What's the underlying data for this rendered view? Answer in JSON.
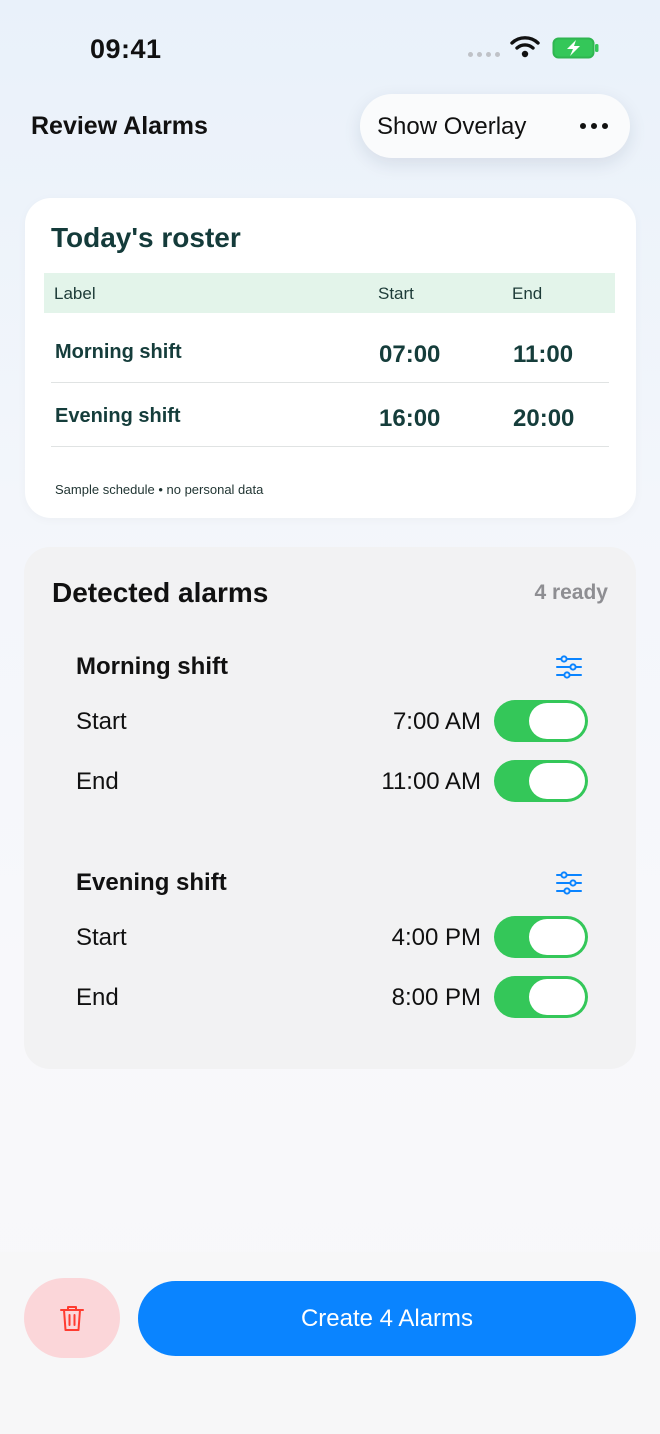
{
  "status_bar": {
    "time": "09:41"
  },
  "header": {
    "title": "Review Alarms",
    "overlay_label": "Show Overlay",
    "more_icon": "ellipsis-icon"
  },
  "roster": {
    "title": "Today's roster",
    "columns": [
      "Label",
      "Start",
      "End"
    ],
    "rows": [
      {
        "label": "Morning shift",
        "start": "07:00",
        "end": "11:00"
      },
      {
        "label": "Evening shift",
        "start": "16:00",
        "end": "20:00"
      }
    ],
    "note": "Sample schedule • no personal data"
  },
  "detected": {
    "title": "Detected alarms",
    "count": "4 ready",
    "groups": [
      {
        "title": "Morning shift",
        "alarms": [
          {
            "label": "Start",
            "time": "7:00 AM",
            "enabled": true
          },
          {
            "label": "End",
            "time": "11:00 AM",
            "enabled": true
          }
        ]
      },
      {
        "title": "Evening shift",
        "alarms": [
          {
            "label": "Start",
            "time": "4:00 PM",
            "enabled": true
          },
          {
            "label": "End",
            "time": "8:00 PM",
            "enabled": true
          }
        ]
      }
    ]
  },
  "actions": {
    "create_label": "Create 4 Alarms",
    "delete_icon": "trash-icon"
  },
  "colors": {
    "accent": "#0a84ff",
    "toggle_on": "#34c759",
    "delete_bg": "#fbd6d9",
    "delete_fg": "#ff3b30",
    "roster_header_bg": "#e3f4ea"
  }
}
